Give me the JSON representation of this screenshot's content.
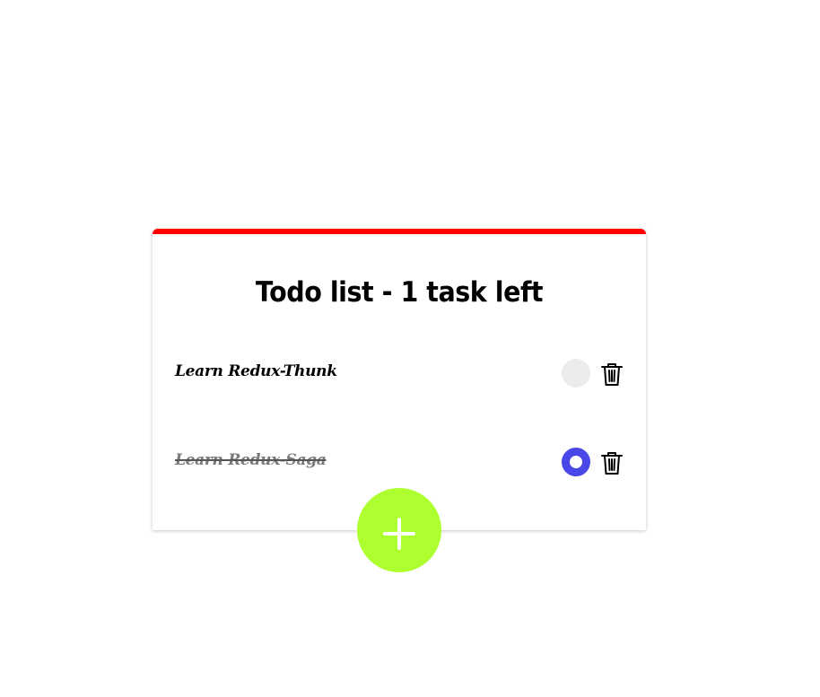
{
  "header": {
    "title": "Todo list - 1 task left"
  },
  "todos": [
    {
      "text": "Learn Redux-Thunk",
      "completed": false
    },
    {
      "text": "Learn Redux-Saga",
      "completed": true
    }
  ],
  "colors": {
    "accent_top_border": "#ff0000",
    "toggle_active": "#4a47e8",
    "toggle_inactive": "#ececec",
    "add_button": "#adff2f"
  },
  "icons": {
    "delete": "trash-icon",
    "add": "plus-icon"
  }
}
